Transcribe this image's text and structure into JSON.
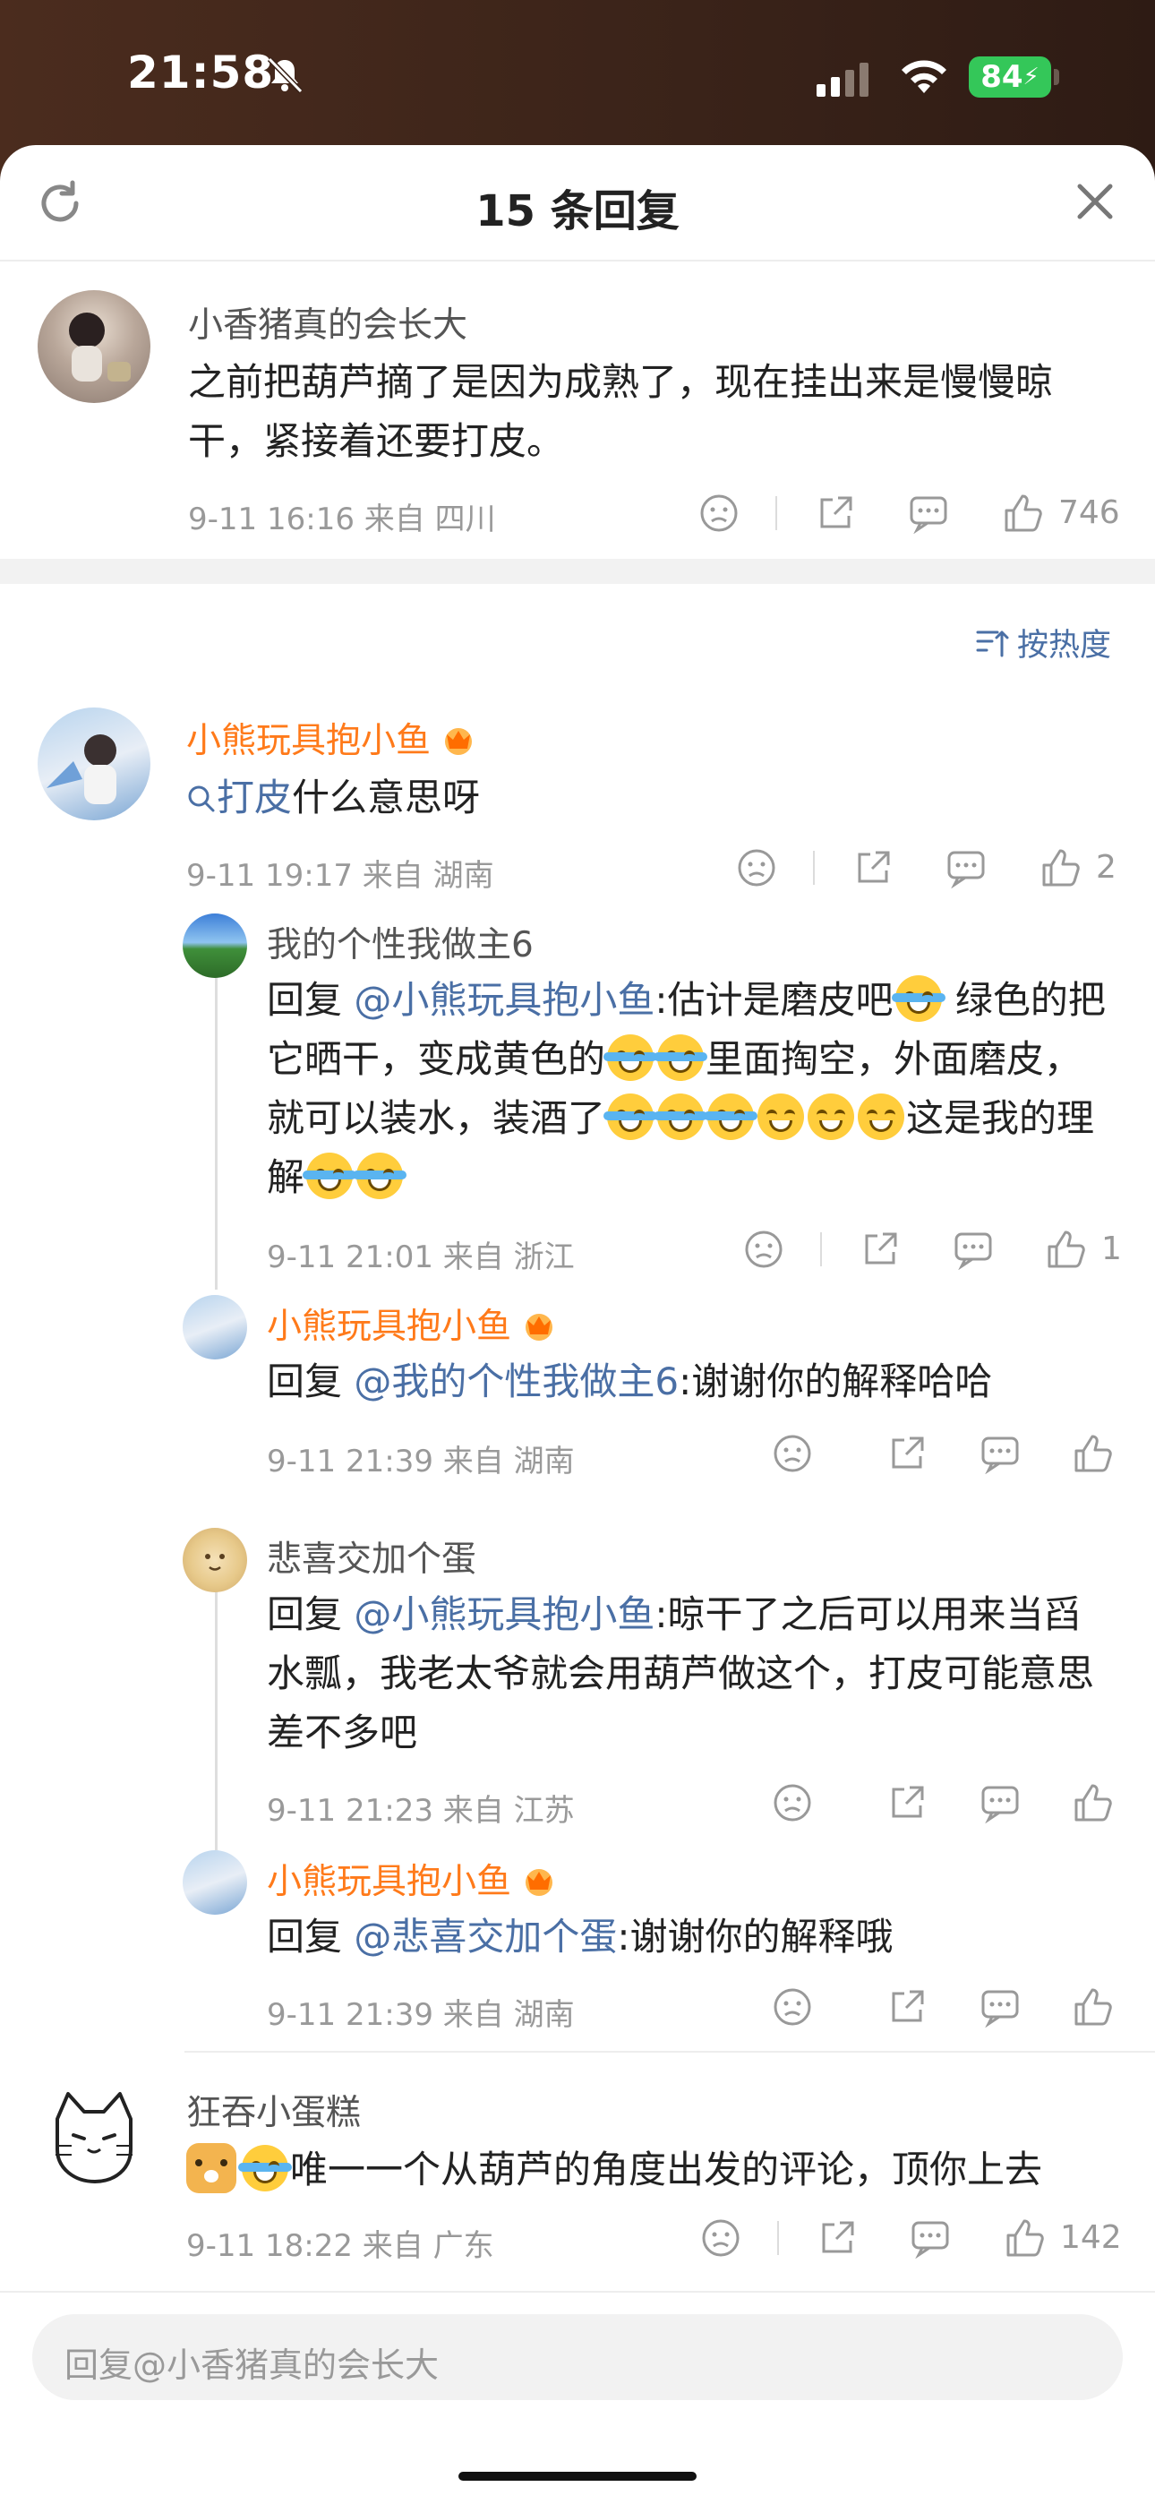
{
  "status_bar": {
    "time": "21:58",
    "battery": "84"
  },
  "header": {
    "title": "15 条回复"
  },
  "main_comment": {
    "username": "小香猪真的会长大",
    "text": "之前把葫芦摘了是因为成熟了，现在挂出来是慢慢晾干，紧接着还要打皮。",
    "meta": "9-11 16:16  来自 四川",
    "likes": "746"
  },
  "sort": {
    "label": "按热度"
  },
  "comments": [
    {
      "username": "小熊玩具抱小鱼",
      "search_term": "打皮",
      "text": "什么意思呀",
      "meta": "9-11 19:17  来自 湖南",
      "likes": "2",
      "replies": [
        {
          "username": "我的个性我做主6",
          "reply_prefix": "回复 ",
          "mention": "@小熊玩具抱小鱼",
          "text_parts": [
            ":估计是磨皮吧",
            "  绿色的把它晒干，变成黄色的",
            "里面掏空，外面磨皮，就可以装水，装酒了",
            "这是我的理解"
          ],
          "meta": "9-11 21:01  来自 浙江",
          "likes": "1"
        },
        {
          "username": "小熊玩具抱小鱼",
          "reply_prefix": "回复 ",
          "mention": "@我的个性我做主6",
          "text": ":谢谢你的解释哈哈",
          "meta": "9-11 21:39  来自 湖南",
          "likes": ""
        },
        {
          "username": "悲喜交加个蛋",
          "reply_prefix": "回复 ",
          "mention": "@小熊玩具抱小鱼",
          "text": ":晾干了之后可以用来当舀水瓢，我老太爷就会用葫芦做这个，打皮可能意思差不多吧",
          "meta": "9-11 21:23  来自 江苏",
          "likes": ""
        },
        {
          "username": "小熊玩具抱小鱼",
          "reply_prefix": "回复 ",
          "mention": "@悲喜交加个蛋",
          "text": ":谢谢你的解释哦",
          "meta": "9-11 21:39  来自 湖南",
          "likes": ""
        }
      ]
    },
    {
      "username": "狂吞小蛋糕",
      "text": "唯一一个从葫芦的角度出发的评论，顶你上去",
      "meta": "9-11 18:22  来自 广东",
      "likes": "142"
    }
  ],
  "input": {
    "placeholder": "回复@小香猪真的会长大"
  },
  "colors": {
    "accent_orange": "#ff7a1a",
    "link_blue": "#4a6fa5",
    "battery_green": "#34c759"
  }
}
